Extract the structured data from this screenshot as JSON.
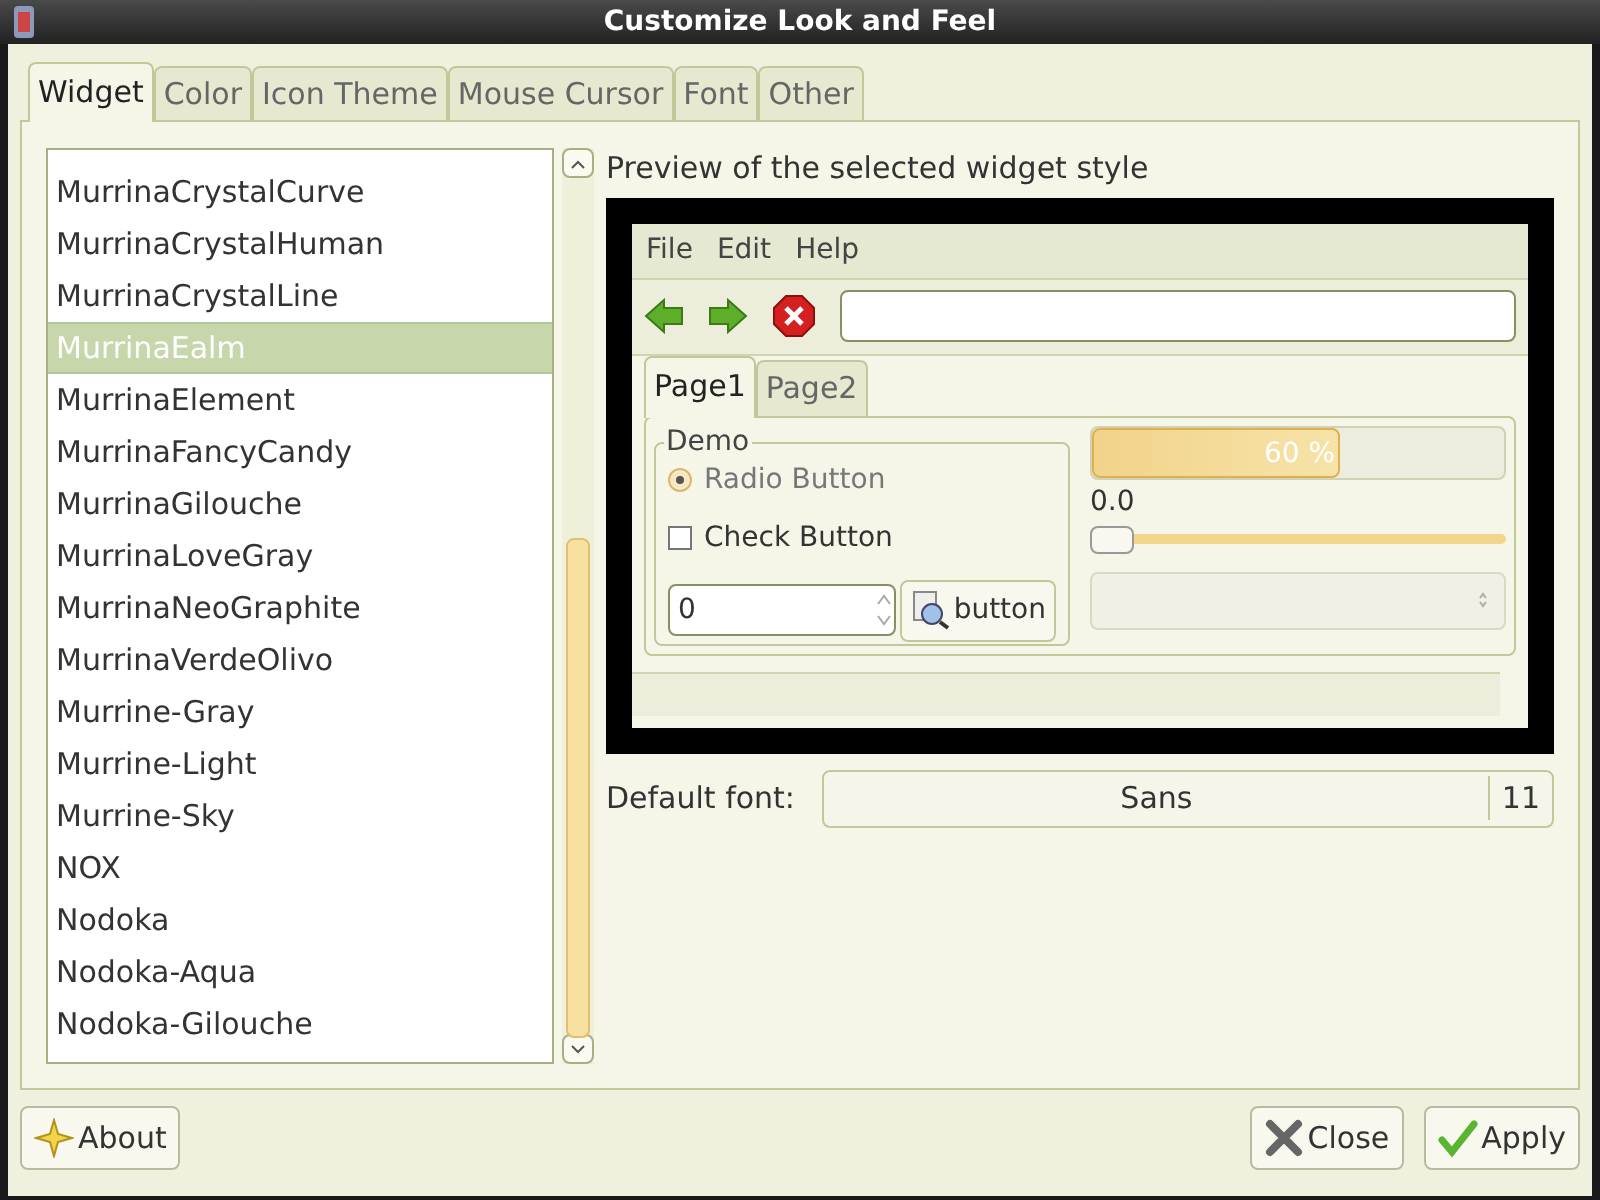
{
  "window": {
    "title": "Customize Look and Feel"
  },
  "tabs": [
    {
      "label": "Widget",
      "selected": true
    },
    {
      "label": "Color",
      "selected": false
    },
    {
      "label": "Icon Theme",
      "selected": false
    },
    {
      "label": "Mouse Cursor",
      "selected": false
    },
    {
      "label": "Font",
      "selected": false
    },
    {
      "label": "Other",
      "selected": false
    }
  ],
  "theme_list": [
    {
      "label": "MurrinaCrystalCurve",
      "selected": false
    },
    {
      "label": "MurrinaCrystalHuman",
      "selected": false
    },
    {
      "label": "MurrinaCrystalLine",
      "selected": false
    },
    {
      "label": "MurrinaEalm",
      "selected": true
    },
    {
      "label": "MurrinaElement",
      "selected": false
    },
    {
      "label": "MurrinaFancyCandy",
      "selected": false
    },
    {
      "label": "MurrinaGilouche",
      "selected": false
    },
    {
      "label": "MurrinaLoveGray",
      "selected": false
    },
    {
      "label": "MurrinaNeoGraphite",
      "selected": false
    },
    {
      "label": "MurrinaVerdeOlivo",
      "selected": false
    },
    {
      "label": "Murrine-Gray",
      "selected": false
    },
    {
      "label": "Murrine-Light",
      "selected": false
    },
    {
      "label": "Murrine-Sky",
      "selected": false
    },
    {
      "label": "NOX",
      "selected": false
    },
    {
      "label": "Nodoka",
      "selected": false
    },
    {
      "label": "Nodoka-Aqua",
      "selected": false
    },
    {
      "label": "Nodoka-Gilouche",
      "selected": false
    }
  ],
  "preview": {
    "label": "Preview of the selected widget style",
    "menu": [
      "File",
      "Edit",
      "Help"
    ],
    "page_tabs": [
      {
        "label": "Page1",
        "selected": true
      },
      {
        "label": "Page2",
        "selected": false
      }
    ],
    "group_label": "Demo",
    "radio": {
      "label": "Radio Button",
      "selected": true,
      "disabled": true
    },
    "check": {
      "label": "Check Button",
      "checked": false
    },
    "spin_value": "0",
    "button": "button",
    "progress": {
      "level": 0.6,
      "reading": "60 %"
    },
    "scale": {
      "reading": "0.0",
      "level": 0
    }
  },
  "default_font": {
    "label": "Default font:",
    "family": "Sans",
    "size": "11"
  },
  "buttons": [
    {
      "kind": "about",
      "label": "About"
    },
    {
      "kind": "close",
      "label": "Close"
    },
    {
      "kind": "apply",
      "label": "Apply"
    }
  ]
}
